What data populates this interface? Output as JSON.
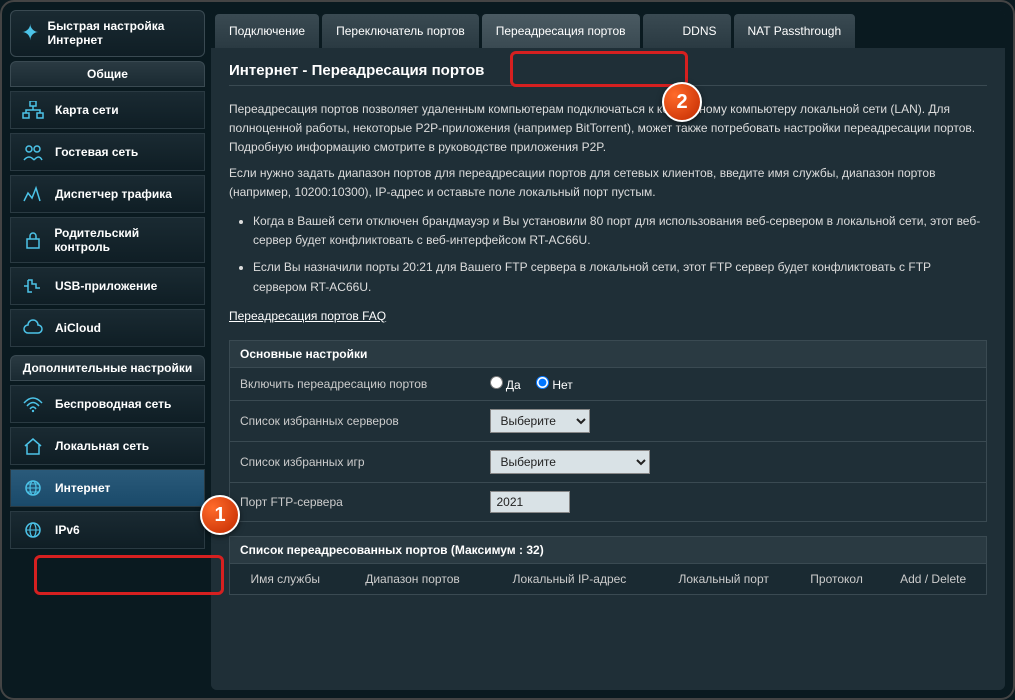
{
  "quick_setup": {
    "title": "Быстрая настройка Интернет"
  },
  "sidebar_sections": {
    "general": {
      "header": "Общие",
      "items": [
        {
          "label": "Карта сети",
          "icon": "network"
        },
        {
          "label": "Гостевая сеть",
          "icon": "guest"
        },
        {
          "label": "Диспетчер трафика",
          "icon": "traffic"
        },
        {
          "label": "Родительский контроль",
          "icon": "lock"
        },
        {
          "label": "USB-приложение",
          "icon": "usb"
        },
        {
          "label": "AiCloud",
          "icon": "cloud"
        }
      ]
    },
    "advanced": {
      "header": "Дополнительные настройки",
      "items": [
        {
          "label": "Беспроводная сеть",
          "icon": "wifi"
        },
        {
          "label": "Локальная сеть",
          "icon": "home"
        },
        {
          "label": "Интернет",
          "icon": "globe",
          "active": true
        },
        {
          "label": "IPv6",
          "icon": "globe"
        }
      ]
    }
  },
  "tabs": [
    {
      "label": "Подключение"
    },
    {
      "label": "Переключатель портов"
    },
    {
      "label": "Переадресация портов",
      "active": true
    },
    {
      "label": "DDNS"
    },
    {
      "label": "NAT Passthrough"
    }
  ],
  "page": {
    "title": "Интернет - Переадресация портов",
    "p1": "Переадресация портов позволяет удаленным компьютерам подключаться к конкретному компьютеру локальной сети (LAN). Для полноценной работы, некоторые P2P-приложения (например BitTorrent), может также потребовать настройки переадресации портов. Подробную информацию смотрите в руководстве приложения P2P.",
    "p2": "Если нужно задать диапазон портов для переадресации портов для сетевых клиентов, введите имя службы, диапазон портов (например, 10200:10300), IP-адрес и оставьте поле локальный порт пустым.",
    "li1": "Когда в Вашей сети отключен брандмауэр и Вы установили 80 порт для использования веб-сервером в локальной сети, этот веб-сервер будет конфликтовать с веб-интерфейсом RT-AC66U.",
    "li2": "Если Вы назначили порты 20:21 для Вашего FTP сервера в локальной сети, этот FTP сервер будет конфликтовать с FTP сервером RT-AC66U.",
    "faq": "Переадресация портов FAQ"
  },
  "settings": {
    "section_basic": "Основные настройки",
    "enable_label": "Включить переадресацию портов",
    "yes": "Да",
    "no": "Нет",
    "servers_label": "Список избранных серверов",
    "games_label": "Список избранных игр",
    "ftp_label": "Порт FTP-сервера",
    "select_placeholder": "Выберите",
    "ftp_value": "2021"
  },
  "port_list": {
    "header": "Список переадресованных портов (Максимум : 32)",
    "cols": [
      "Имя службы",
      "Диапазон портов",
      "Локальный IP-адрес",
      "Локальный порт",
      "Протокол",
      "Add / Delete"
    ]
  },
  "badges": {
    "one": "1",
    "two": "2"
  }
}
